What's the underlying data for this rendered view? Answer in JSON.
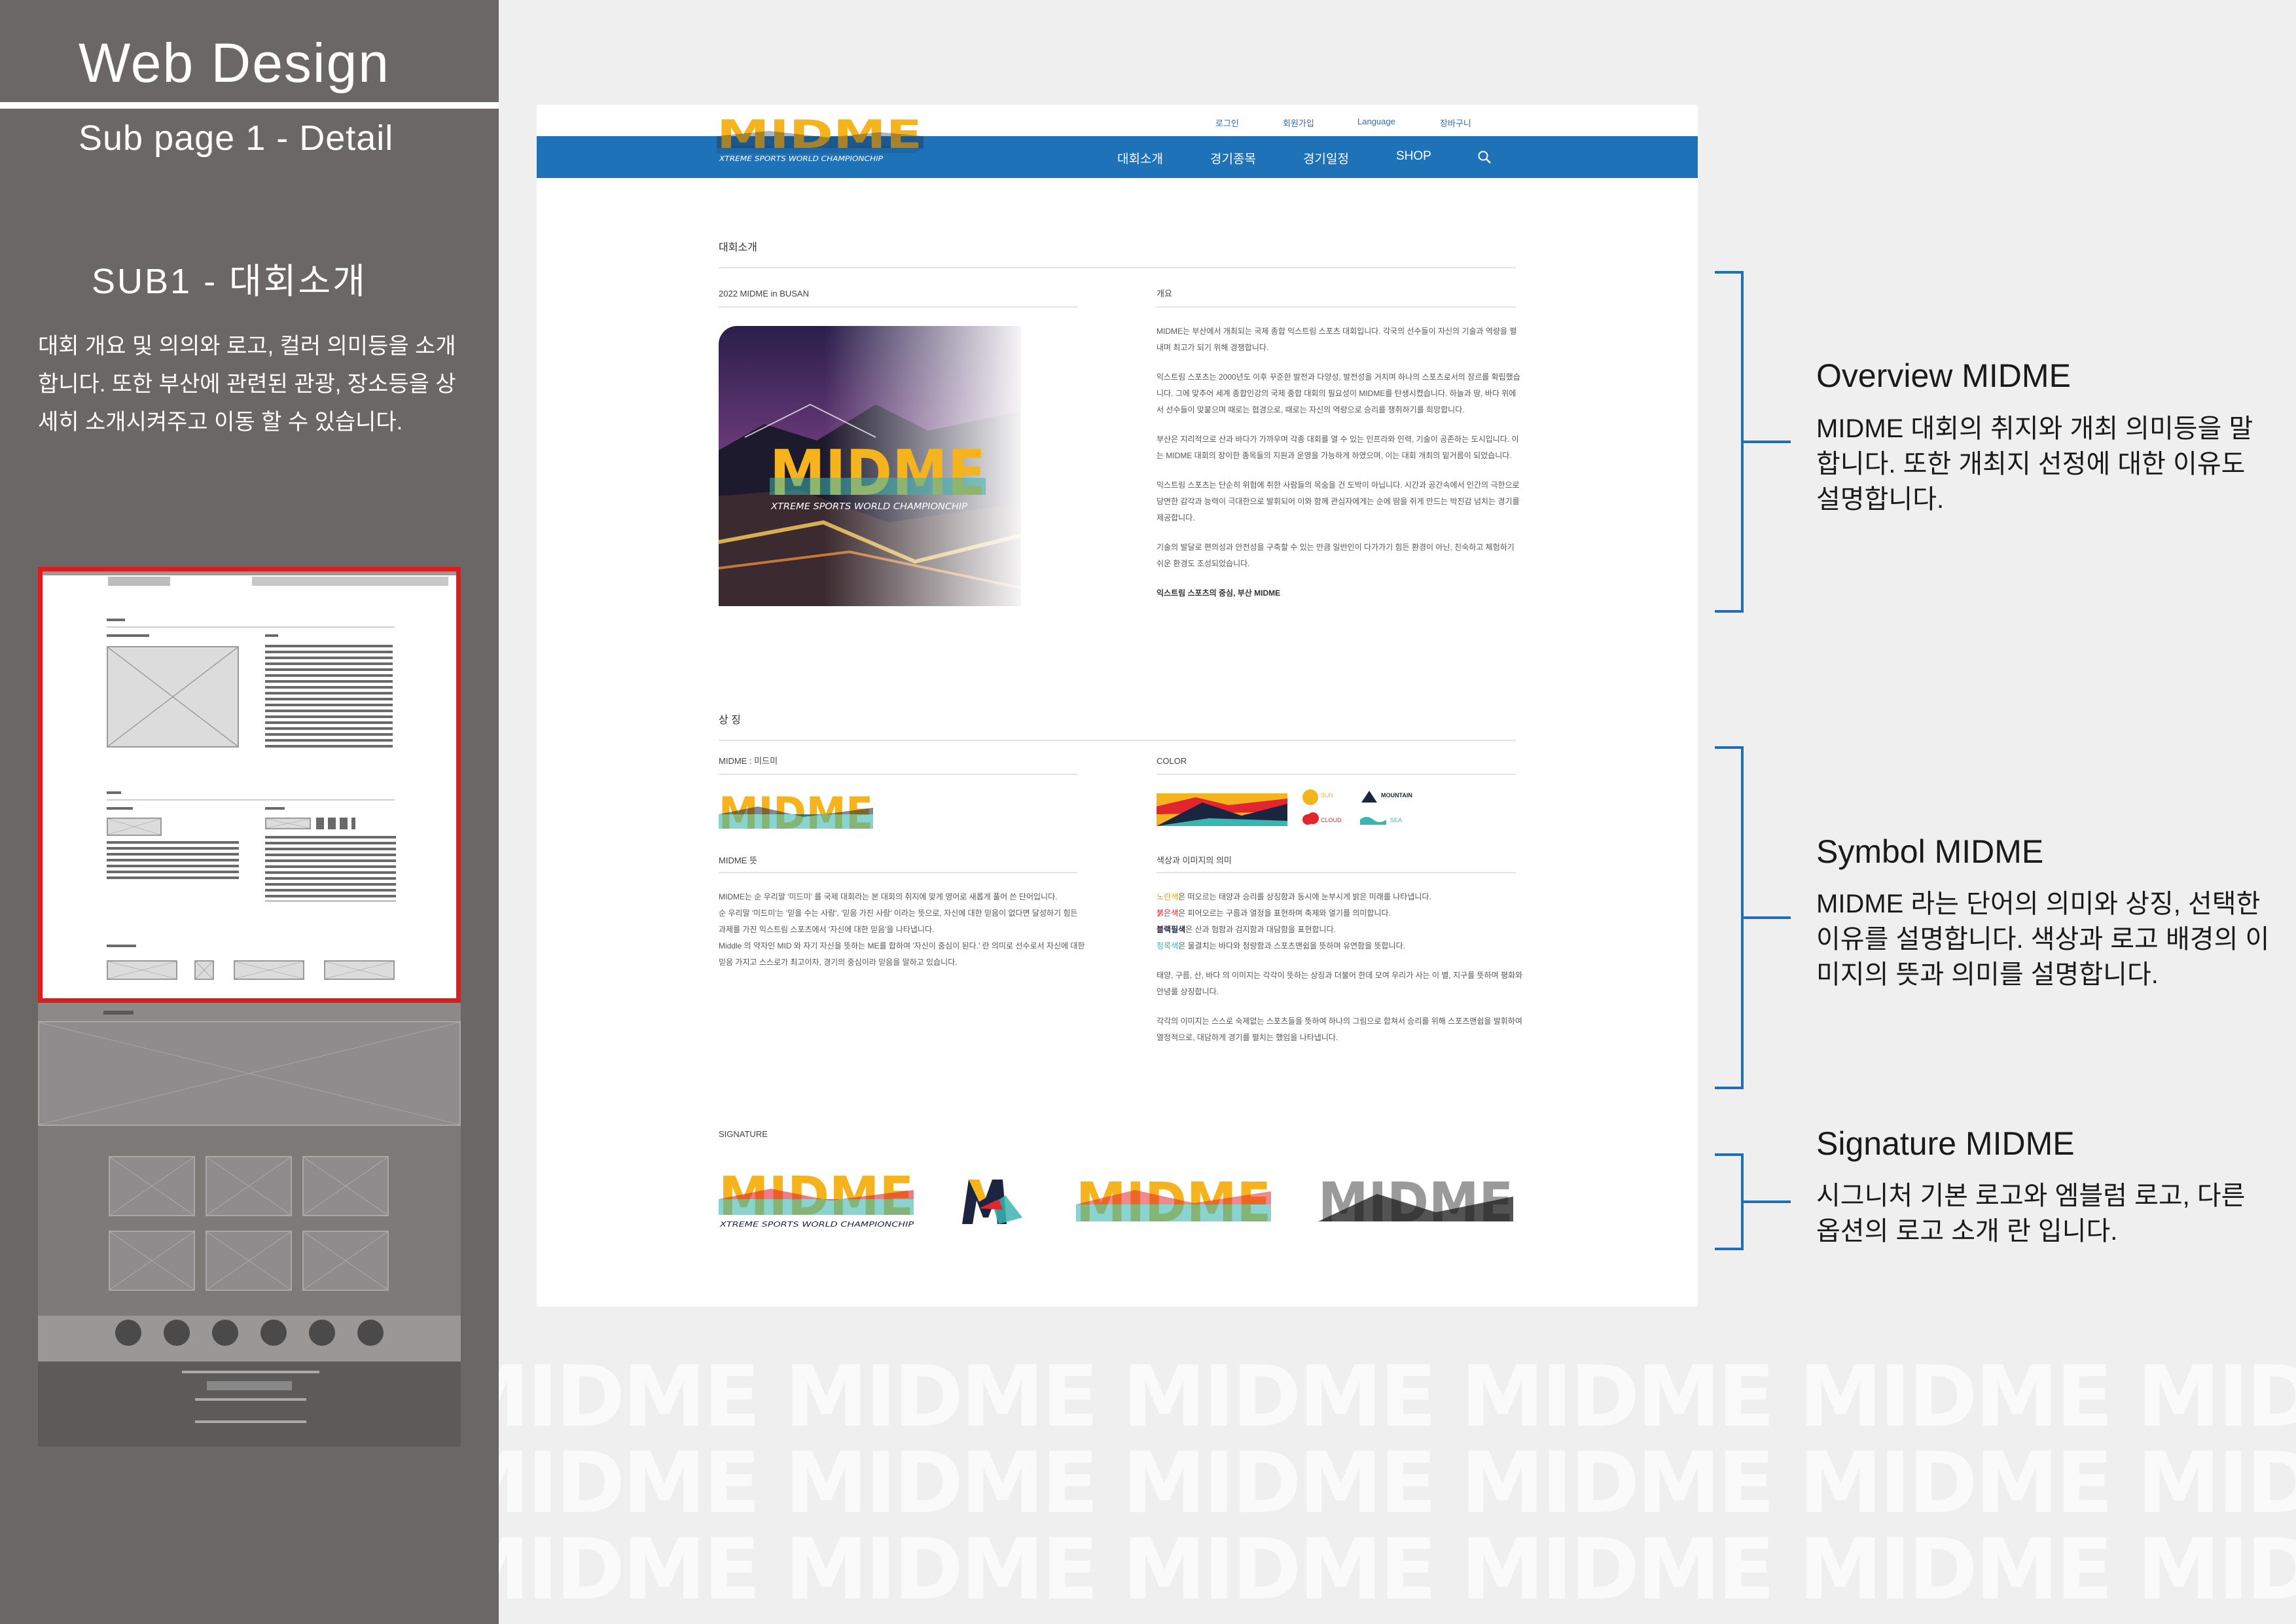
{
  "left_panel": {
    "title": "Web Design",
    "subtitle": "Sub page 1 - Detail",
    "section": "SUB1 - 대회소개",
    "description": "대회 개요 및 의의와 로고, 컬러 의미등을 소개합니다. 또한 부산에 관련된 관광, 장소등을 상세히 소개시켜주고 이동 할 수 있습니다."
  },
  "header": {
    "top_links": [
      "로그인",
      "회원가입",
      "Language",
      "장바구니"
    ],
    "nav": [
      "대회소개",
      "경기종목",
      "경기일정",
      "SHOP"
    ],
    "logo_text": "MIDME",
    "logo_tagline": "XTREME SPORTS WORLD CHAMPIONCHIP"
  },
  "intro": {
    "heading": "대회소개",
    "left_label": "2022 MIDME in BUSAN",
    "right_label": "개요",
    "paragraphs": [
      "MIDME는 부산에서 개최되는 국제 종합 익스트림 스포츠 대회입니다. 각국의 선수들이 자신의 기술과 역량을 펼내며 최고가 되기 위해 경쟁합니다.",
      "익스트림 스포츠는 2000년도 이후 꾸준한 발전과 다양성, 발전성을 거치며 하나의 스포츠로서의 장르를 확립했습니다. 그에 맞추어 세계 종합인강의 국제 종합 대회의 필요성이 MIDME를 탄생시켰습니다. 하늘과 땅, 바다 위에서 선수들이 맞붙으며 때로는 협경으로, 때로는 자신의 역량으로 승리를 쟁취하기를 희망합니다.",
      "부산은 지리적으로 산과 바다가 가까우며 각종 대회를 열 수 있는 인프라와 인력, 기술이 공존하는 도시입니다. 이는 MIDME 대회의 장이한 종목들의 지원과 운영을 가능하게 하였으며, 이는 대회 개최의 밑거름이 되었습니다.",
      "익스트림 스포츠는 단순히 위험에 취한 사람들의 목숨을 건 도박이 아닙니다. 시간과 공간속에서 인간의 극한으로 당면한 감각과 능력이 극대한으로 발휘되어 이와 함께 관심자에게는 순에 땀을 쥐게 만드는 박진감 넘치는 경기를 제공합니다.",
      "기술의 발달로 편의성과 안전성을 구축할 수 있는 만큼 일반인이 다가가기 힘든 환경이 아닌, 친숙하고 체험하기 쉬운 환경도 조성되었습니다."
    ],
    "closing": "익스트림 스포츠의 중심, 부산 MIDME"
  },
  "symbol": {
    "heading": "상 징",
    "left_label": "MIDME : 미드미",
    "right_label": "COLOR",
    "meaning_title": "MIDME 뜻",
    "meaning_text": [
      "MIDME는 순 우리말 '미드미' 를 국제 대회라는 본 대회의 취지에 맞게 영어로 새롭게 풀어 쓴 단어입니다.",
      "순 우리말 '미드미'는 '믿을 수는 사람', '믿음 가진 사람' 이라는 뜻으로, 자신에 대한 믿음이 없다면 달성하기 힘든 과제를 가진 익스트림 스포츠에서 '자신에 대한 믿음'을 나타냅니다.",
      "Middle 의 약자인 MID 와 자기 자신을 뜻하는 ME를 합하여 '자신이 중심이 된다.' 란 의미로 선수로서 자신에 대한 믿음 가지고 스스로가 최고이자, 경기의 중심이라 믿음을 말하고 있습니다."
    ],
    "legend": [
      {
        "label": "SUN",
        "color": "#f5b41e"
      },
      {
        "label": "MOUNTAIN",
        "color": "#1b2540"
      },
      {
        "label": "CLOUD",
        "color": "#e3262e"
      },
      {
        "label": "SEA",
        "color": "#3ab5b0"
      }
    ],
    "color_title": "색상과 이미지의 의미",
    "color_lines": [
      {
        "word": "노란색",
        "rest": "은 떠오르는 태양과 승리를 상징함과 동시에 눈부시게 밝은 미래를 나타냅니다."
      },
      {
        "word": "붉은색",
        "rest": "은 피어오르는 구름과 열정을 표현하며 축제와 열기를 의미합니다."
      },
      {
        "word": "블랙필색",
        "rest": "은 산과 험함과 검지함과 대담함을 표현합니다."
      },
      {
        "word": "청록색",
        "rest": "은 물결치는 바다와 청량함과 스포츠맨쉽을 뜻하며 유연함을 뜻합니다."
      }
    ],
    "color_extra": [
      "태양, 구름, 산, 바다 의 이미지는 각각이 뜻하는 상징과 더불어 한데 모여 우리가 사는 이 별, 지구를 뜻하며 평화와 안녕를 상징합니다.",
      "각각의 이미지는 스스로 숙제없는 스포츠들을 뜻하여 하나의 그림으로 합쳐서 승리를 위해 스포츠맨쉽을 발휘하여 열정적으로, 대담하게 경기를 펼치는 했임을 나타냅니다."
    ]
  },
  "signature": {
    "heading": "SIGNATURE"
  },
  "annotations": [
    {
      "title": "Overview MIDME",
      "text": "MIDME 대회의 취지와 개최 의미등을 말합니다. 또한 개최지 선정에 대한 이유도 설명합니다."
    },
    {
      "title": "Symbol MIDME",
      "text": "MIDME 라는 단어의 의미와 상징, 선택한 이유를 설명합니다. 색상과 로고 배경의 이미지의 뜻과 의미를 설명합니다."
    },
    {
      "title": "Signature MIDME",
      "text": "시그니처 기본 로고와 엠블럼 로고, 다른 옵션의 로고 소개 란 입니다."
    }
  ],
  "watermark": "MIDME MIDME MIDME MIDME MIDME MIDME MIDME MIDME MIDME",
  "colors": {
    "nav_blue": "#1e73b8",
    "panel_gray": "#6b6767",
    "accent_red": "#e01b1b",
    "annotation_blue": "#1e6fb5"
  }
}
